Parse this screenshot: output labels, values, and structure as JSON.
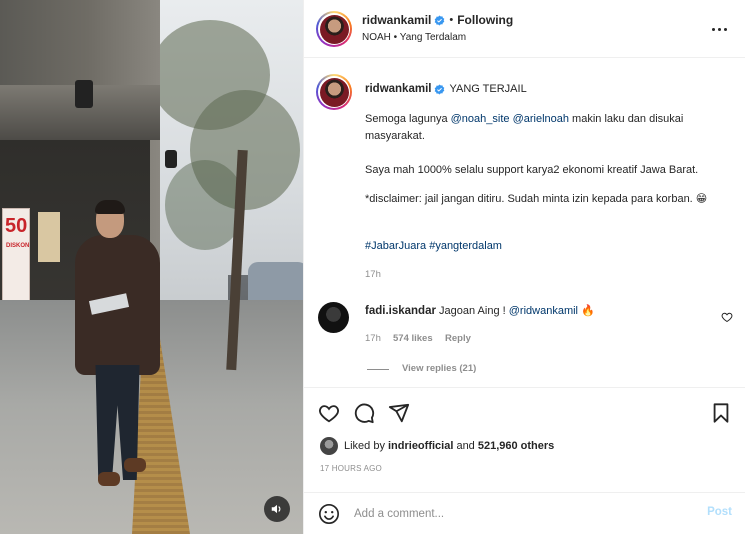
{
  "post": {
    "author": "ridwankamil",
    "follow_status": "Following",
    "audio": "NOAH • Yang Terdalam",
    "caption_title": "YANG TERJAIL",
    "caption_line1_pre": "Semoga lagunya ",
    "caption_mention1": "@noah_site",
    "caption_mention2": "@arielnoah",
    "caption_line1_post": " makin laku dan disukai masyarakat.",
    "caption_line2": "Saya mah 1000% selalu support karya2 ekonomi kreatif Jawa Barat.",
    "caption_line3": "*disclaimer: jail jangan ditiru. Sudah minta izin kepada para korban. 😁",
    "hashtags": "#JabarJuara #yangterdalam",
    "caption_time": "17h"
  },
  "comment": {
    "author": "fadi.iskandar",
    "text_pre": "Jagoan Aing ! ",
    "mention": "@ridwankamil",
    "emoji": "🔥",
    "time": "17h",
    "likes": "574 likes",
    "reply": "Reply",
    "view_replies": "View replies (21)"
  },
  "likes": {
    "prefix": "Liked by ",
    "user": "indrieofficial",
    "middle": " and ",
    "count": "521,960 others"
  },
  "timestamp": "17 HOURS AGO",
  "comment_input": {
    "placeholder": "Add a comment...",
    "post_label": "Post"
  },
  "media_sign": {
    "number": "50",
    "label": "DISKON"
  },
  "icons": {
    "verified": "verified-badge-icon",
    "more": "more-options-icon",
    "like": "heart-icon",
    "comment": "comment-icon",
    "share": "share-icon",
    "save": "bookmark-icon",
    "emoji": "emoji-icon",
    "sound": "speaker-icon"
  },
  "colors": {
    "verified": "#3897f0",
    "link": "#00376b",
    "muted": "#8e8e8e",
    "post_disabled": "#b2dffc"
  }
}
